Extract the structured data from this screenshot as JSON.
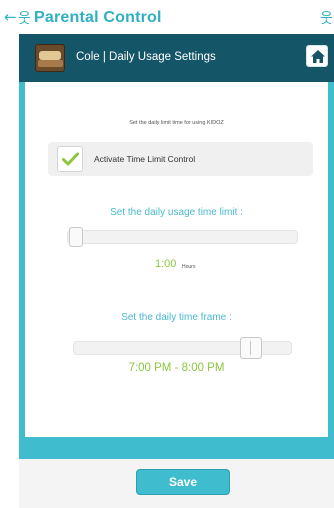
{
  "topbar": {
    "back_icon": "←",
    "logo_icon": "웃",
    "title": "Parental Control",
    "corner_icon": "웃"
  },
  "header": {
    "title": "Cole | Daily Usage Settings",
    "home_icon": "home-icon"
  },
  "settings": {
    "instruction": "Set the daily limit time for using KIDOZ",
    "activate_label": "Activate Time Limit Control",
    "activate_checked": true,
    "usage_heading": "Set the daily usage time limit :",
    "usage_value": "1:00",
    "usage_unit": "Hours",
    "usage_level": 0.0,
    "frame_heading": "Set the daily time frame :",
    "frame_value": "7:00 PM - 8:00 PM",
    "frame_level": 0.8
  },
  "footer": {
    "save_label": "Save"
  },
  "colors": {
    "accent": "#3fbccd",
    "header_bg": "#145567",
    "value_green": "#8cc63f"
  }
}
